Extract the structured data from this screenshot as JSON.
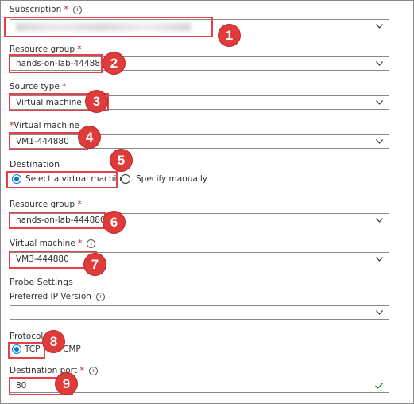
{
  "subscription": {
    "label": "Subscription",
    "required": "*",
    "value": ""
  },
  "resource_group_1": {
    "label": "Resource group",
    "required": "*",
    "value": "hands-on-lab-444880"
  },
  "source_type": {
    "label": "Source type",
    "required": "*",
    "value": "Virtual machine"
  },
  "virtual_machine_1": {
    "required": "*",
    "label": "Virtual machine",
    "value": "VM1-444880"
  },
  "destination": {
    "label": "Destination",
    "options": [
      "Select a virtual machine",
      "Specify manually"
    ],
    "selected": "Select a virtual machine"
  },
  "resource_group_2": {
    "label": "Resource group",
    "required": "*",
    "value": "hands-on-lab-444880"
  },
  "virtual_machine_2": {
    "label": "Virtual machine",
    "required": "*",
    "value": "VM3-444880"
  },
  "probe_settings": {
    "heading": "Probe Settings"
  },
  "preferred_ip": {
    "label": "Preferred IP Version",
    "value": ""
  },
  "protocol": {
    "label": "Protocol",
    "options": [
      "TCP",
      "ICMP"
    ],
    "visible_text": [
      "TCP",
      "CMP"
    ],
    "selected": "TCP"
  },
  "destination_port": {
    "label": "Destination port",
    "required": "*",
    "value": "80"
  },
  "callouts": [
    "1",
    "2",
    "3",
    "4",
    "5",
    "6",
    "7",
    "8",
    "9"
  ],
  "colors": {
    "accent": "#0078d4",
    "callout": "#e03a3a",
    "highlight": "#e8404a",
    "valid": "#107c10"
  },
  "icons": {
    "info": "info-icon",
    "dropdown": "chevron-down-icon",
    "valid": "checkmark-icon"
  }
}
